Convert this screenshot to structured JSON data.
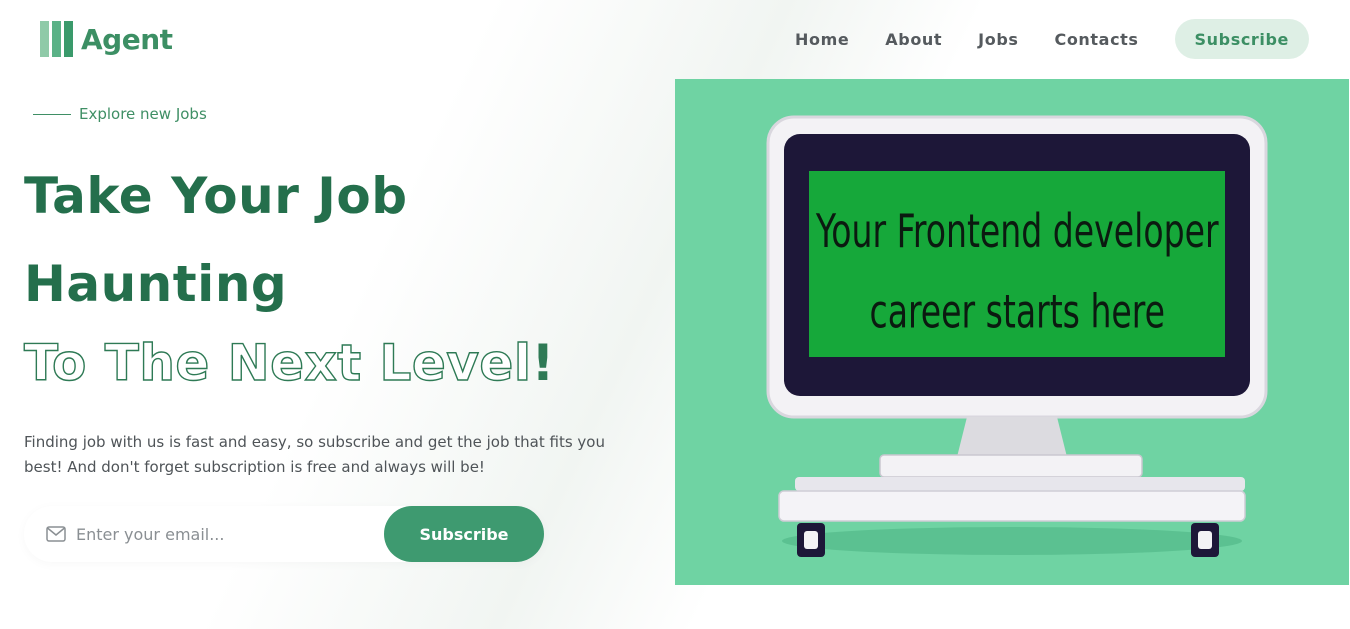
{
  "brand": {
    "name": "Agent",
    "colors": {
      "accent": "#3e9a70",
      "accent_light": "#deefe5",
      "dark_green": "#246f4c"
    }
  },
  "nav": {
    "items": [
      {
        "label": "Home"
      },
      {
        "label": "About"
      },
      {
        "label": "Jobs"
      },
      {
        "label": "Contacts"
      }
    ],
    "subscribe_label": "Subscribe"
  },
  "hero": {
    "eyebrow": "Explore new Jobs",
    "headline_line1": "Take Your Job",
    "headline_line2": "Haunting",
    "headline_outline": "To The Next Level",
    "headline_bang": "!",
    "description": "Finding job with us is fast and easy, so subscribe and get the job that fits you best! And don't forget subscription is free and always will be!",
    "email_placeholder": "Enter your email...",
    "email_icon": "mail-icon",
    "subscribe_label": "Subscribe"
  },
  "illustration": {
    "screen_line1": "Your Frontend developer",
    "screen_line2": "career starts here"
  }
}
